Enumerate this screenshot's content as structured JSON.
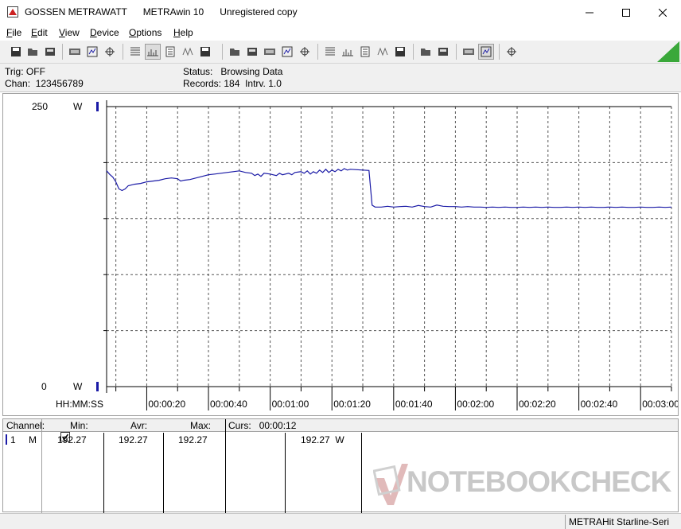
{
  "window": {
    "brand": "GOSSEN METRAWATT",
    "app": "METRAwin 10",
    "license": "Unregistered copy"
  },
  "menu": [
    {
      "label": "File",
      "key": "F"
    },
    {
      "label": "Edit",
      "key": "E"
    },
    {
      "label": "View",
      "key": "V"
    },
    {
      "label": "Device",
      "key": "D"
    },
    {
      "label": "Options",
      "key": "O"
    },
    {
      "label": "Help",
      "key": "H"
    }
  ],
  "toolbar_icons": [
    "open-icon",
    "save-icon",
    "save-as-icon",
    "device-read-icon",
    "device-write-icon",
    "device-settings-icon",
    "table-view-icon",
    "graph-view-icon",
    "cursor-icon",
    "grid-icon",
    "bar-icon",
    "copy-icon",
    "export-icon",
    "list-icon",
    "computer-icon",
    "fx-icon",
    "signal-icon",
    "wave-icon",
    "wave-alt-icon",
    "zoom-icon",
    "color-icon",
    "print-preview-icon",
    "print-icon",
    "zoom-wave-icon",
    "zoom-wave-alt-icon",
    "comment-icon"
  ],
  "status": {
    "trig_label": "Trig:",
    "trig_value": "OFF",
    "chan_label": "Chan:",
    "chan_value": "123456789",
    "status_label": "Status:",
    "status_value": "Browsing Data",
    "records_label": "Records:",
    "records_value": "184",
    "interval_label": "Intrv.",
    "interval_value": "1.0"
  },
  "chart_data": {
    "type": "line",
    "y_unit": "W",
    "ylim": [
      0,
      250
    ],
    "y_tick_labels": [
      "250",
      "0"
    ],
    "x_axis_label": "HH:MM:SS",
    "x_tick_labels": [
      "00:00:20",
      "00:00:40",
      "00:01:00",
      "00:01:20",
      "00:01:40",
      "00:02:00",
      "00:02:20",
      "00:02:40",
      "00:03:00"
    ],
    "xlim_seconds": [
      7,
      190
    ],
    "grid": true,
    "line_color": "#1a1aa6",
    "series": [
      {
        "points": [
          [
            7,
            192.7
          ],
          [
            8,
            189.5
          ],
          [
            9,
            187
          ],
          [
            10,
            182.8
          ],
          [
            11,
            176.5
          ],
          [
            12,
            175.1
          ],
          [
            13,
            176.5
          ],
          [
            14,
            179.3
          ],
          [
            16,
            180.7
          ],
          [
            18,
            181.4
          ],
          [
            20,
            182.8
          ],
          [
            22,
            183.5
          ],
          [
            24,
            184.2
          ],
          [
            26,
            185.6
          ],
          [
            28,
            186.3
          ],
          [
            30,
            185.6
          ],
          [
            31,
            183.5
          ],
          [
            32,
            184.2
          ],
          [
            34,
            184.9
          ],
          [
            36,
            186.3
          ],
          [
            38,
            187.7
          ],
          [
            40,
            189.1
          ],
          [
            42,
            189.8
          ],
          [
            44,
            190.5
          ],
          [
            46,
            191.2
          ],
          [
            48,
            191.9
          ],
          [
            50,
            192.6
          ],
          [
            52,
            191.2
          ],
          [
            54,
            190.5
          ],
          [
            55,
            188.4
          ],
          [
            56,
            189.8
          ],
          [
            57,
            187.7
          ],
          [
            58,
            190.5
          ],
          [
            60,
            189.8
          ],
          [
            62,
            188.4
          ],
          [
            63,
            190.5
          ],
          [
            64,
            189.1
          ],
          [
            66,
            190.5
          ],
          [
            67,
            189.1
          ],
          [
            68,
            191.2
          ],
          [
            70,
            191.9
          ],
          [
            71,
            190.5
          ],
          [
            72,
            192.6
          ],
          [
            73,
            189.8
          ],
          [
            74,
            191.9
          ],
          [
            75,
            190.5
          ],
          [
            76,
            193.3
          ],
          [
            77,
            191.2
          ],
          [
            78,
            194
          ],
          [
            79,
            191.2
          ],
          [
            80,
            193.3
          ],
          [
            81,
            191.9
          ],
          [
            82,
            194
          ],
          [
            83,
            192.6
          ],
          [
            84,
            194.7
          ],
          [
            85,
            193.3
          ],
          [
            86,
            194
          ],
          [
            92,
            193
          ],
          [
            93,
            162
          ],
          [
            94,
            160.3
          ],
          [
            96,
            160.3
          ],
          [
            98,
            161
          ],
          [
            100,
            160.3
          ],
          [
            102,
            160.7
          ],
          [
            104,
            161
          ],
          [
            106,
            160.3
          ],
          [
            108,
            161.7
          ],
          [
            110,
            160.7
          ],
          [
            112,
            160.3
          ],
          [
            114,
            162.1
          ],
          [
            116,
            161
          ],
          [
            118,
            160.7
          ],
          [
            120,
            160.7
          ],
          [
            122,
            160.3
          ],
          [
            124,
            160.7
          ],
          [
            126,
            160.3
          ],
          [
            128,
            160.3
          ],
          [
            130,
            160
          ],
          [
            132,
            160.3
          ],
          [
            134,
            160
          ],
          [
            136,
            160.3
          ],
          [
            138,
            160
          ],
          [
            140,
            160
          ],
          [
            142,
            160.3
          ],
          [
            144,
            160
          ],
          [
            146,
            160.3
          ],
          [
            148,
            160
          ],
          [
            150,
            160.3
          ],
          [
            152,
            160
          ],
          [
            154,
            160
          ],
          [
            156,
            160.3
          ],
          [
            158,
            160
          ],
          [
            160,
            160.3
          ],
          [
            162,
            160
          ],
          [
            164,
            160.3
          ],
          [
            166,
            160
          ],
          [
            168,
            160
          ],
          [
            170,
            160.3
          ],
          [
            172,
            160
          ],
          [
            174,
            160.3
          ],
          [
            176,
            160
          ],
          [
            178,
            160
          ],
          [
            180,
            160.3
          ],
          [
            182,
            160
          ],
          [
            184,
            160
          ],
          [
            186,
            160.3
          ],
          [
            188,
            160
          ],
          [
            190,
            160.3
          ]
        ]
      }
    ]
  },
  "table": {
    "headers": {
      "channel": "Channel:",
      "min": "Min:",
      "avr": "Avr:",
      "max": "Max:",
      "curs_label": "Curs:",
      "curs_value": "00:00:12"
    },
    "row": {
      "channel_num": "1",
      "channel_mode": "M",
      "min": "192.27",
      "avr": "192.27",
      "max": "192.27",
      "cursor_value": "192.27",
      "cursor_unit": "W"
    }
  },
  "statusbar": {
    "device": "METRAHit Starline-Seri"
  },
  "watermark": {
    "text_part1": "NOTEBOOK",
    "text_part2": "CHECK"
  }
}
